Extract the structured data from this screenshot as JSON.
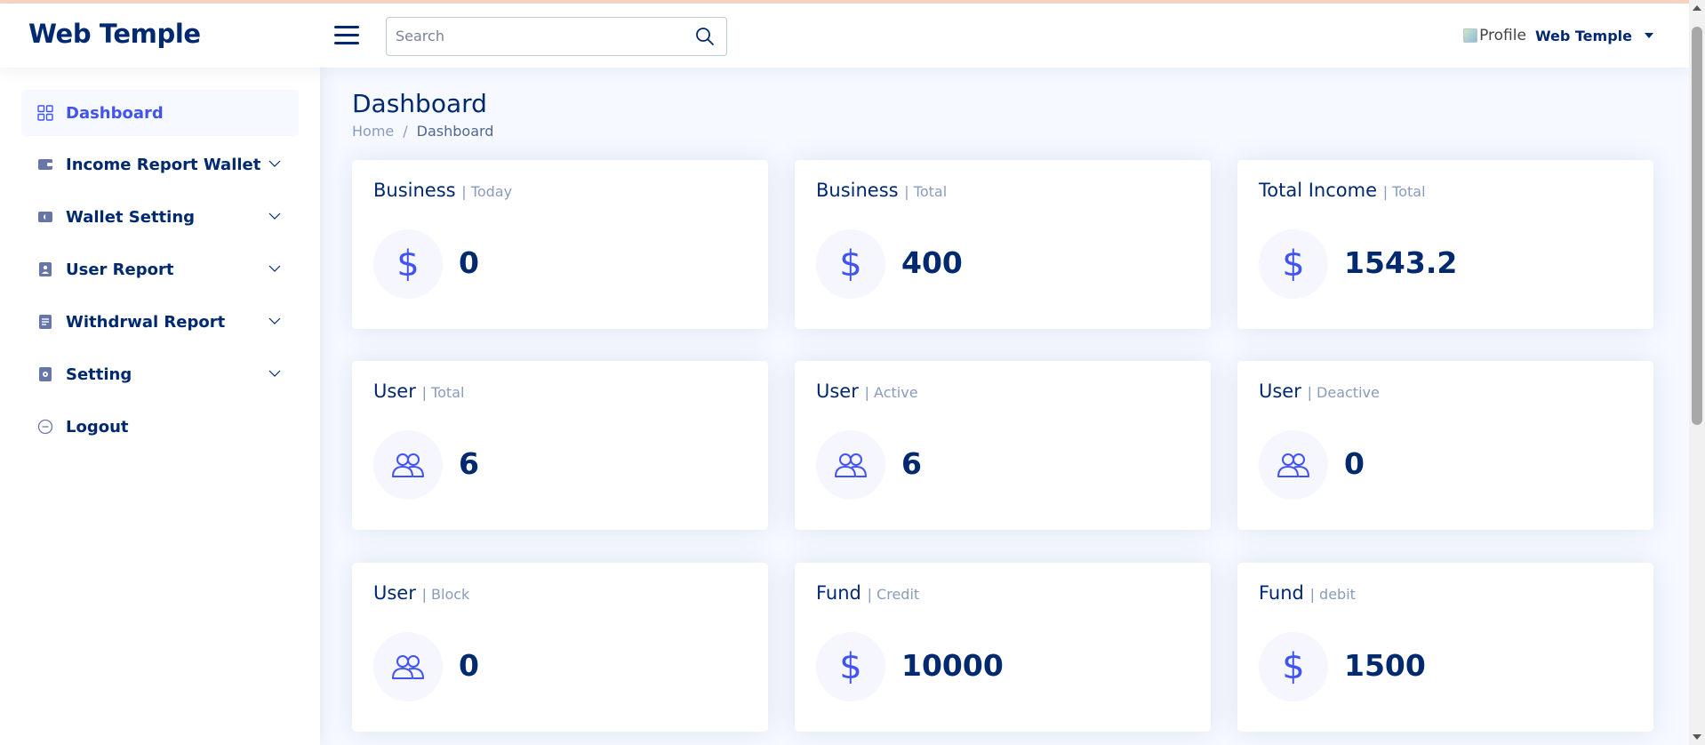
{
  "header": {
    "logo": "Web Temple",
    "search_placeholder": "Search",
    "profile_image_alt": "Profile",
    "profile_name": "Web Temple"
  },
  "sidebar": {
    "items": [
      {
        "label": "Dashboard",
        "icon": "grid-icon",
        "active": true,
        "expandable": false
      },
      {
        "label": "Income Report Wallet",
        "icon": "wallet-icon",
        "active": false,
        "expandable": true
      },
      {
        "label": "Wallet Setting",
        "icon": "wallet-icon",
        "active": false,
        "expandable": true
      },
      {
        "label": "User Report",
        "icon": "file-person-icon",
        "active": false,
        "expandable": true
      },
      {
        "label": "Withdrwal Report",
        "icon": "file-text-icon",
        "active": false,
        "expandable": true
      },
      {
        "label": "Setting",
        "icon": "file-gear-icon",
        "active": false,
        "expandable": true
      },
      {
        "label": "Logout",
        "icon": "dash-circle-icon",
        "active": false,
        "expandable": false
      }
    ]
  },
  "main": {
    "title": "Dashboard",
    "breadcrumb": {
      "home": "Home",
      "separator": "/",
      "current": "Dashboard"
    },
    "cards": [
      {
        "title": "Business",
        "sub": "| Today",
        "value": "0",
        "icon": "dollar-icon"
      },
      {
        "title": "Business",
        "sub": "| Total",
        "value": "400",
        "icon": "dollar-icon"
      },
      {
        "title": "Total Income",
        "sub": "| Total",
        "value": "1543.2",
        "icon": "dollar-icon"
      },
      {
        "title": "User",
        "sub": "| Total",
        "value": "6",
        "icon": "people-icon"
      },
      {
        "title": "User",
        "sub": "| Active",
        "value": "6",
        "icon": "people-icon"
      },
      {
        "title": "User",
        "sub": "| Deactive",
        "value": "0",
        "icon": "people-icon"
      },
      {
        "title": "User",
        "sub": "| Block",
        "value": "0",
        "icon": "people-icon"
      },
      {
        "title": "Fund",
        "sub": "| Credit",
        "value": "10000",
        "icon": "dollar-icon"
      },
      {
        "title": "Fund",
        "sub": "| debit",
        "value": "1500",
        "icon": "dollar-icon"
      }
    ],
    "dollar_symbol": "$"
  },
  "colors": {
    "primary": "#4154f1",
    "navy": "#012970",
    "muted": "#899bbd",
    "background": "#f6f9ff"
  }
}
